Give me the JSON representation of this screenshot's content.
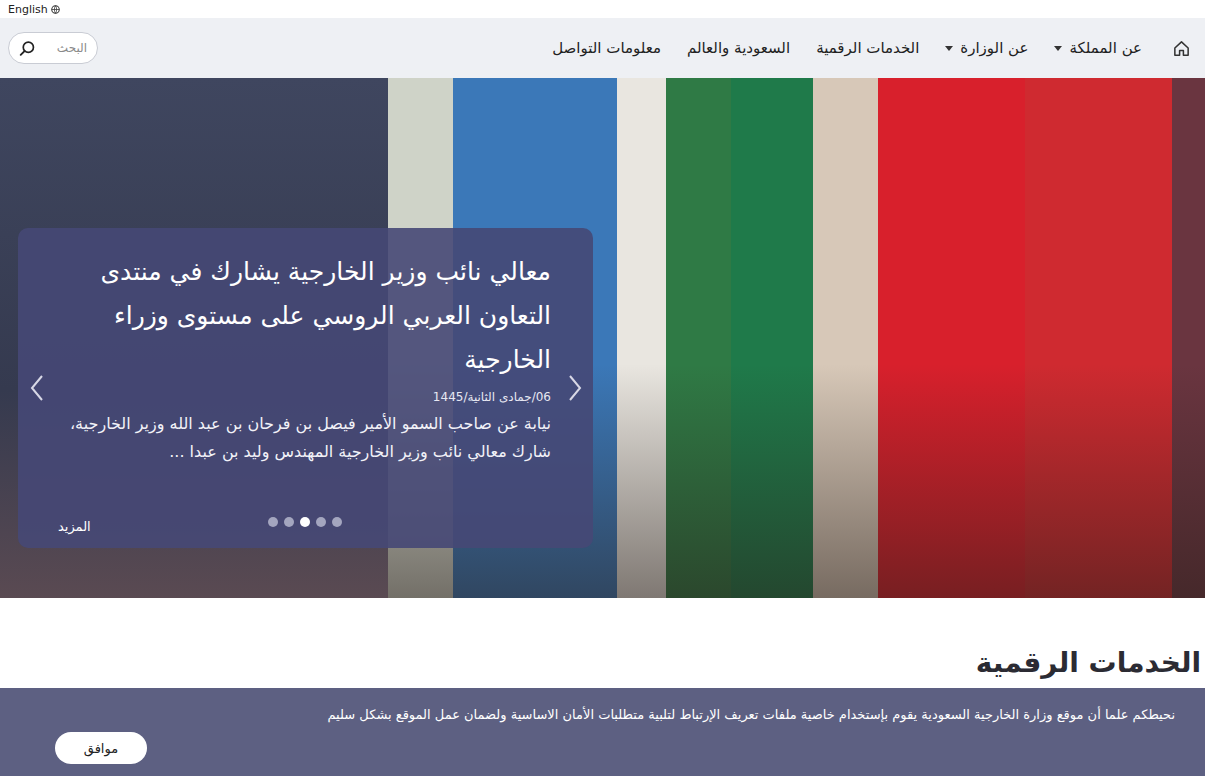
{
  "top_bar": {
    "language_link": "English"
  },
  "nav": {
    "items": [
      {
        "label": "عن المملكة",
        "dropdown": true
      },
      {
        "label": "عن الوزارة",
        "dropdown": true
      },
      {
        "label": "الخدمات الرقمية",
        "dropdown": false
      },
      {
        "label": "السعودية والعالم",
        "dropdown": false
      },
      {
        "label": "معلومات التواصل",
        "dropdown": false
      }
    ],
    "search": {
      "placeholder": "البحث"
    }
  },
  "hero": {
    "slide": {
      "title": "معالي نائب وزير الخارجية يشارك في منتدى التعاون العربي الروسي على مستوى وزراء الخارجية",
      "date": "06/جمادى الثانية/1445",
      "excerpt": "نيابة عن صاحب السمو الأمير فيصل بن فرحان بن عبد الله وزير الخارجية، شارك معالي نائب وزير الخارجية المهندس وليد بن عبدا ...",
      "more": "المزيد"
    },
    "dots": [
      {
        "selected": false
      },
      {
        "selected": false
      },
      {
        "selected": true
      },
      {
        "selected": false
      },
      {
        "selected": false
      }
    ]
  },
  "section": {
    "title": "الخدمات الرقمية"
  },
  "cookie_banner": {
    "text": "نحيطكم علما أن موقع وزارة الخارجية السعودية يقوم بإستخدام خاصية ملفات تعريف الإرتباط لتلبية متطلبات الأمان الاساسية ولضمان عمل الموقع بشكل سليم",
    "button": "موافق"
  }
}
